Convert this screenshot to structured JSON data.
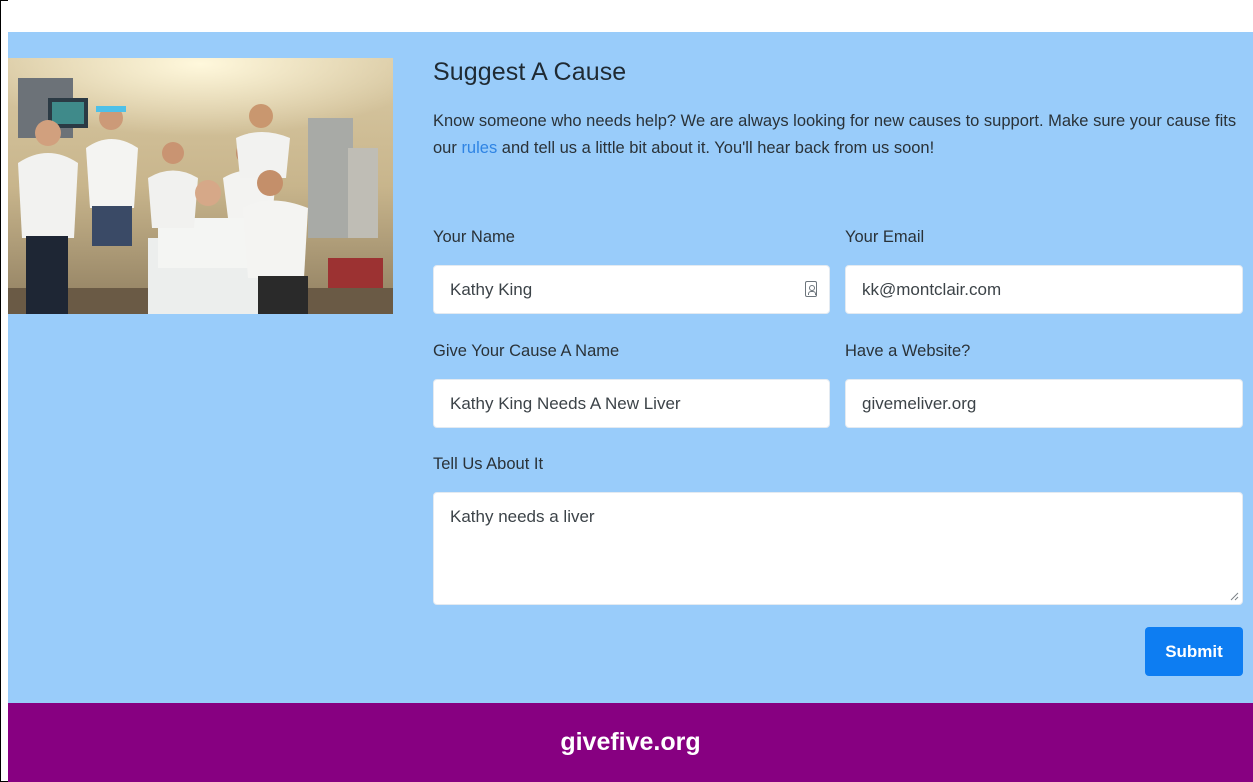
{
  "header": {
    "title": "Suggest A Cause"
  },
  "intro": {
    "text_before": "Know someone who needs help? We are always looking for new causes to support. Make sure your cause fits our ",
    "link": "rules",
    "text_after": " and tell us a little bit about it. You'll hear back from us soon!"
  },
  "form": {
    "name_label": "Your Name",
    "name_value": "Kathy King",
    "email_label": "Your Email",
    "email_value": "kk@montclair.com",
    "cause_label": "Give Your Cause A Name",
    "cause_value": "Kathy King Needs A New Liver",
    "website_label": "Have a Website?",
    "website_value": "givemeliver.org",
    "about_label": "Tell Us About It",
    "about_value": "Kathy needs a liver",
    "submit_label": "Submit"
  },
  "footer": {
    "brand": "givefive.org"
  },
  "icons": {
    "autofill": "contact-card-icon",
    "resize": "resize-grip-icon"
  },
  "colors": {
    "main_bg": "#99ccfa",
    "footer_bg": "#870081",
    "button_bg": "#0d7df2",
    "link": "#2f84e4"
  }
}
